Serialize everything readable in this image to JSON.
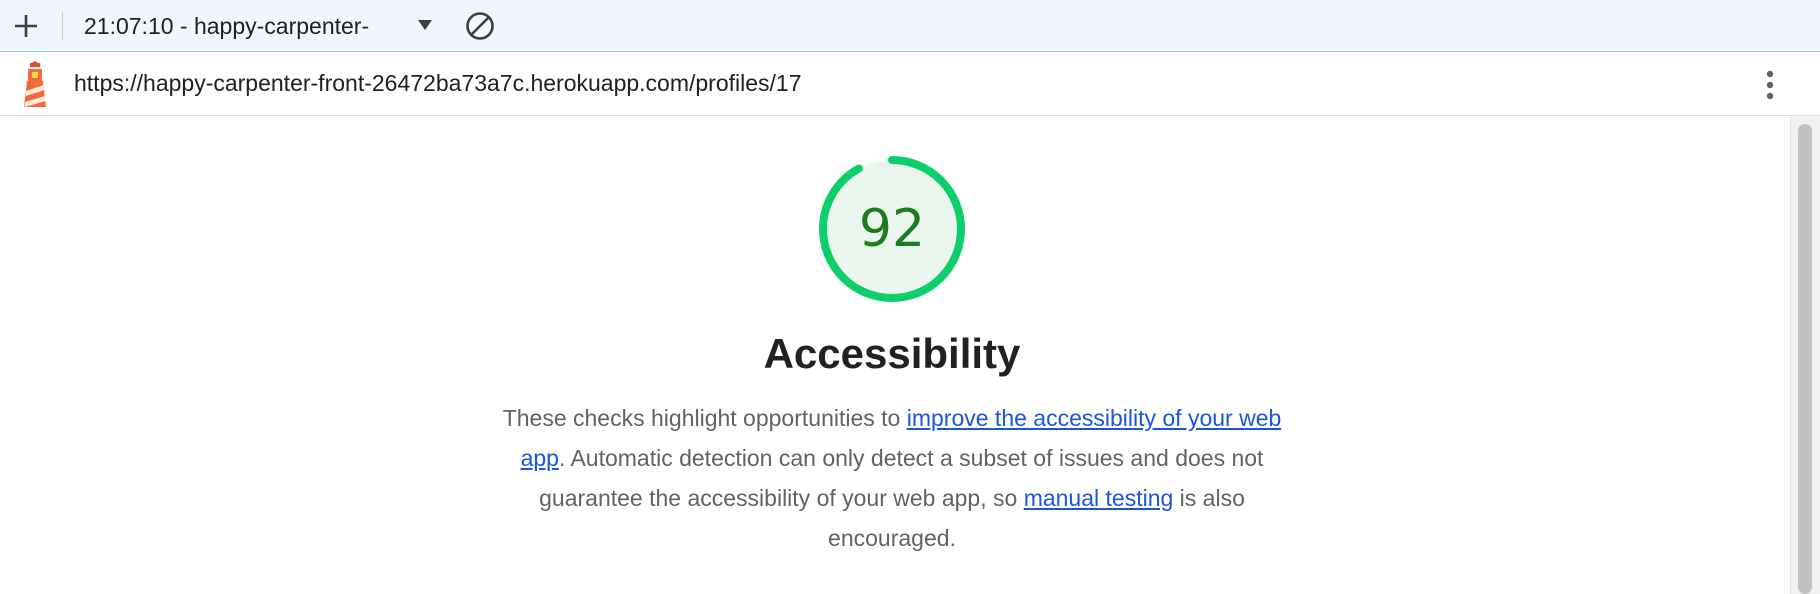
{
  "toolbar": {
    "add_icon": "plus-icon",
    "report_title": "21:07:10 - happy-carpenter-",
    "caret_icon": "caret-down-icon",
    "clear_icon": "block-icon"
  },
  "urlbar": {
    "logo_icon": "lighthouse-icon",
    "url": "https://happy-carpenter-front-26472ba73a7c.herokuapp.com/profiles/17",
    "menu_icon": "kebab-menu-icon"
  },
  "category": {
    "score": "92",
    "score_fraction": 0.92,
    "score_color": "#0cce6b",
    "score_text_color": "#1d7c1d",
    "title": "Accessibility",
    "desc_part1": "These checks highlight opportunities to ",
    "desc_link1": "improve the accessibility of your web app",
    "desc_part2": ". Automatic detection can only detect a subset of issues and does not guarantee the accessibility of your web app, so ",
    "desc_link2": "manual testing",
    "desc_part3": " is also encouraged."
  },
  "colors": {
    "link": "#1a56db",
    "gauge_fill": "#0cce6b",
    "gauge_bg": "#ebf7ee",
    "toolbar_bg": "#f3f6f9"
  }
}
